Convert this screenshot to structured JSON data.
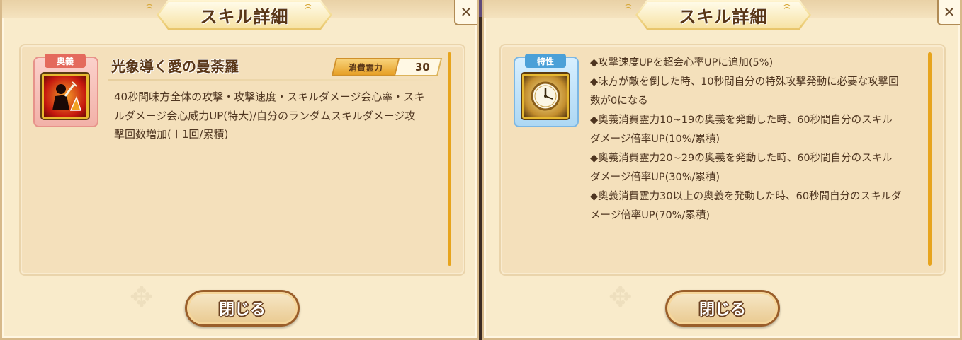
{
  "left_panel": {
    "title": "スキル詳細",
    "category_tag": "奥義",
    "skill_name": "光象導く愛の曼荼羅",
    "cost_label": "消費霊力",
    "cost_value": "30",
    "description": "40秒間味方全体の攻撃・攻撃速度・スキルダメージ会心率・スキルダメージ会心威力UP(特大)/自分のランダムスキルダメージ攻撃回数増加(＋1回/累積)",
    "close_label": "閉じる"
  },
  "right_panel": {
    "title": "スキル詳細",
    "category_tag": "特性",
    "traits": [
      "◆攻撃速度UPを超会心率UPに追加(5%)",
      "◆味方が敵を倒した時、10秒間自分の特殊攻撃発動に必要な攻撃回数が0になる",
      "◆奥義消費霊力10~19の奥義を発動した時、60秒間自分のスキルダメージ倍率UP(10%/累積)",
      "◆奥義消費霊力20~29の奥義を発動した時、60秒間自分のスキルダメージ倍率UP(30%/累積)",
      "◆奥義消費霊力30以上の奥義を発動した時、60秒間自分のスキルダメージ倍率UP(70%/累積)"
    ],
    "close_label": "閉じる"
  },
  "icons": {
    "left_skill": "sword-warrior-icon",
    "right_skill": "clock-icon",
    "corner": "close-corner-icon",
    "title_ornament": "swirl-icon"
  },
  "colors": {
    "panel_bg": "#f9ebcb",
    "accent_gold": "#e7a41d",
    "tag_red": "#e46a5d",
    "tag_blue": "#4ba0d8",
    "text_brown": "#4e3520"
  }
}
